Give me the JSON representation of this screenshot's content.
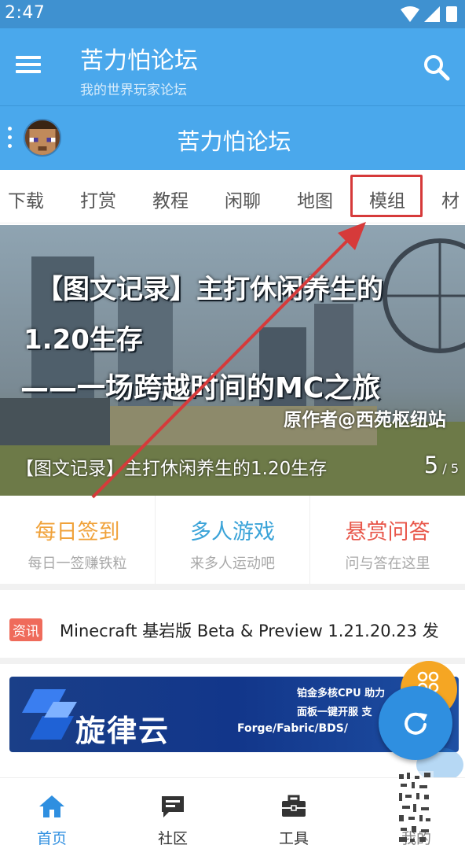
{
  "status_bar": {
    "time": "2:47"
  },
  "app_bar": {
    "title": "苦力怕论坛",
    "subtitle": "我的世界玩家论坛"
  },
  "sub_bar": {
    "title": "苦力怕论坛"
  },
  "tabs": [
    "下载",
    "打赏",
    "教程",
    "闲聊",
    "地图",
    "模组",
    "材"
  ],
  "highlighted_tab": "模组",
  "banner": {
    "line1": "【图文记录】主打休闲养生的",
    "line2": "1.20生存",
    "line3": "——一场跨越时间的MC之旅",
    "author": "原作者@西苑枢纽站",
    "caption": "【图文记录】主打休闲养生的1.20生存",
    "page_current": "5",
    "page_total": "/ 5"
  },
  "quick_actions": [
    {
      "title": "每日签到",
      "subtitle": "每日一签赚铁粒",
      "color": "#f0a23a"
    },
    {
      "title": "多人游戏",
      "subtitle": "来多人运动吧",
      "color": "#3aa3d8"
    },
    {
      "title": "悬赏问答",
      "subtitle": "问与答在这里",
      "color": "#e8574a"
    }
  ],
  "news": {
    "badge": "资讯",
    "title": "Minecraft 基岩版 Beta & Preview 1.21.20.23 发"
  },
  "ad": {
    "brand": "旋律云",
    "line1": "铂金多核CPU  助力",
    "line2": "面板一键开服  支",
    "line3": "Forge/Fabric/BDS/"
  },
  "bottom_nav": [
    {
      "label": "首页",
      "icon": "home-icon",
      "active": true
    },
    {
      "label": "社区",
      "icon": "chat-icon",
      "active": false
    },
    {
      "label": "工具",
      "icon": "toolbox-icon",
      "active": false
    },
    {
      "label": "我的",
      "icon": "person-icon",
      "active": false
    }
  ],
  "colors": {
    "primary": "#4aa8ec",
    "status_bar": "#3f91d0",
    "highlight": "#d63a3a",
    "fab": "#2f8fe0",
    "fab_secondary": "#f5a623"
  }
}
